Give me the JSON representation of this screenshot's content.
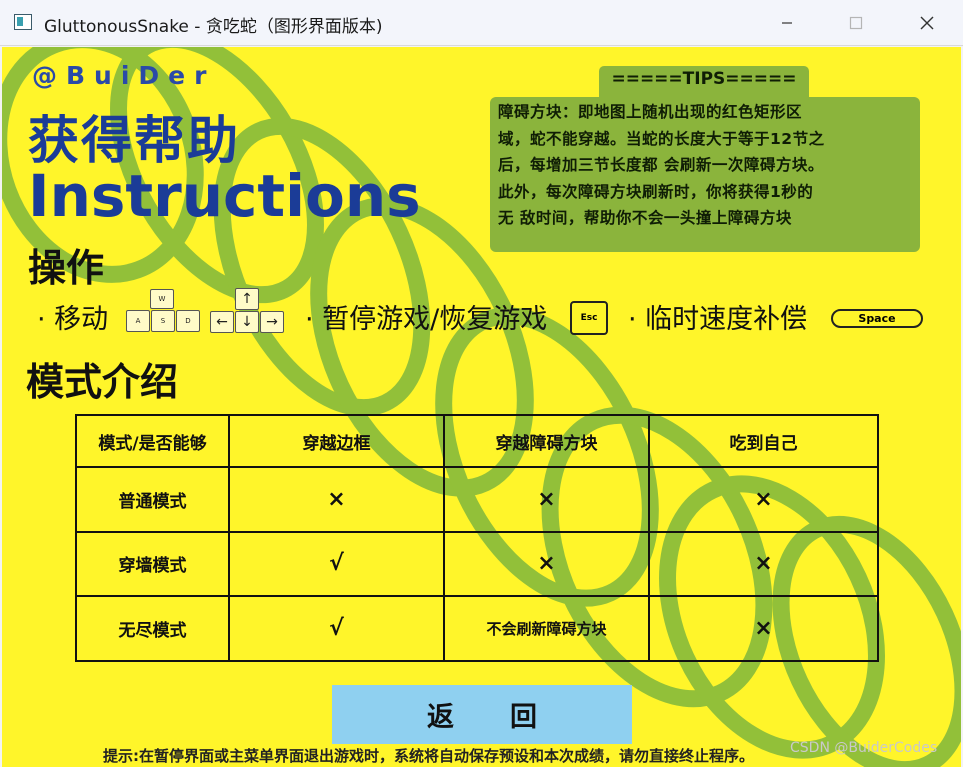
{
  "window": {
    "title": "GluttonousSnake - 贪吃蛇（图形界面版本)",
    "minimize_icon": "minimize-icon",
    "maximize_icon": "maximize-icon",
    "close_icon": "close-icon"
  },
  "page": {
    "credit": "@BuiDer",
    "heading_cn": "获得帮助",
    "heading_en": "Instructions"
  },
  "controls": {
    "title": "操作",
    "move_label": "· 移动",
    "wasd_keys": [
      "W",
      "A",
      "S",
      "D"
    ],
    "arrow_keys": [
      "↑",
      "←",
      "↓",
      "→"
    ],
    "pause_label": "· 暂停游戏/恢复游戏",
    "esc_key": "Esc",
    "boost_label": "· 临时速度补偿",
    "space_key": "Space"
  },
  "tips": {
    "title": "=====TIPS=====",
    "lines": [
      "障碍方块：即地图上随机出现的红色矩形区",
      "域，蛇不能穿越。当蛇的长度大于等于12节之",
      "后，每增加三节长度都 会刷新一次障碍方块。",
      "此外，每次障碍方块刷新时，你将获得1秒的",
      "无 敌时间，帮助你不会一头撞上障碍方块"
    ]
  },
  "modes": {
    "title": "模式介绍",
    "headers": [
      "模式/是否能够",
      "穿越边框",
      "穿越障碍方块",
      "吃到自己"
    ],
    "rows": [
      [
        "普通模式",
        "×",
        "×",
        "×"
      ],
      [
        "穿墙模式",
        "√",
        "×",
        "×"
      ],
      [
        "无尽模式",
        "√",
        "不会刷新障碍方块",
        "×"
      ]
    ]
  },
  "back_button": "返回",
  "hint": "提示:在暂停界面或主菜单界面退出游戏时，系统将自动保存预设和本次成绩，请勿直接终止程序。",
  "watermark": "CSDN @BuiderCodes",
  "colors": {
    "background": "#fff52a",
    "accent_blue": "#1b3c97",
    "tips_green": "#8bb43c",
    "button_blue": "#8fd0f0"
  }
}
